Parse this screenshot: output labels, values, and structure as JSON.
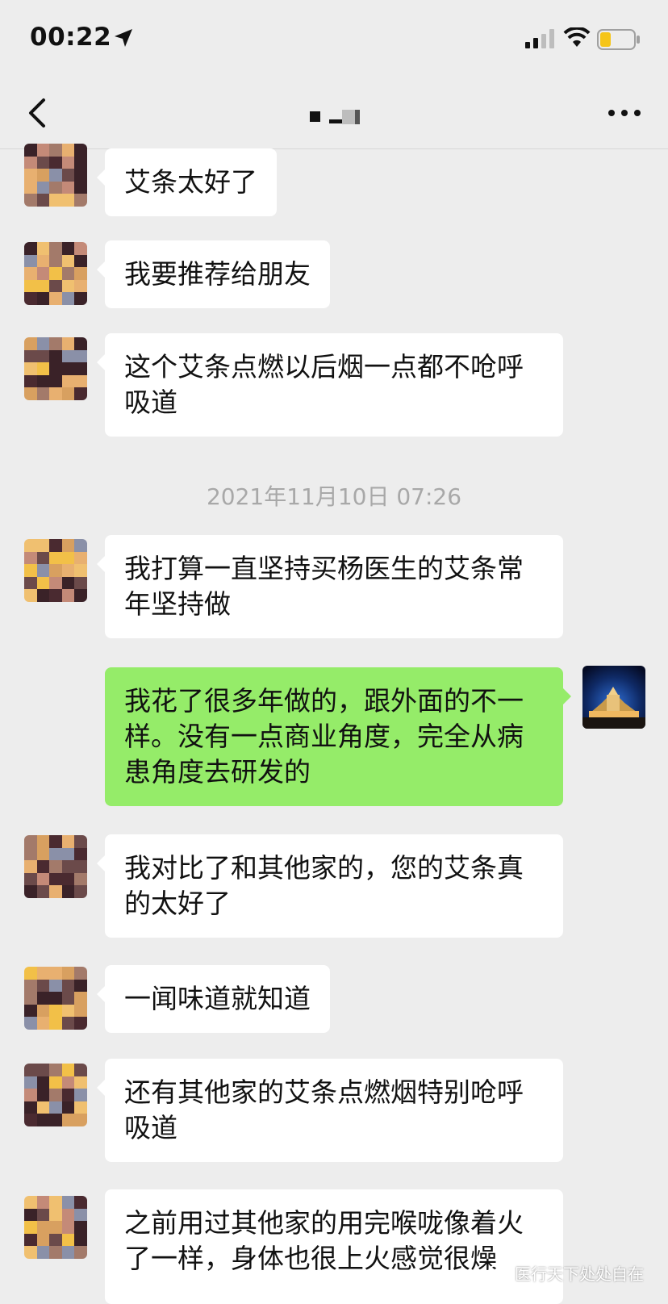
{
  "status_bar": {
    "time": "00:22",
    "icons": [
      "location-arrow-icon",
      "cellular-signal-icon",
      "wifi-icon",
      "battery-low-icon"
    ],
    "battery_color": "#f5c518"
  },
  "nav": {
    "back_icon": "chevron-left-icon",
    "title": "■ ▁▒",
    "more_icon": "ellipsis-icon"
  },
  "messages": [
    {
      "direction": "in",
      "text": "艾条太好了"
    },
    {
      "direction": "in",
      "text": "我要推荐给朋友"
    },
    {
      "direction": "in",
      "text": "这个艾条点燃以后烟一点都不呛呼吸道"
    },
    {
      "direction": "in",
      "text": "我打算一直坚持买杨医生的艾条常年坚持做"
    },
    {
      "direction": "out",
      "text": "我花了很多年做的，跟外面的不一样。没有一点商业角度，完全从病患角度去研发的"
    },
    {
      "direction": "in",
      "text": "我对比了和其他家的，您的艾条真的太好了"
    },
    {
      "direction": "in",
      "text": "一闻味道就知道"
    },
    {
      "direction": "in",
      "text": "还有其他家的艾条点燃烟特别呛呼吸道"
    },
    {
      "direction": "in",
      "text": "之前用过其他家的用完喉咙像着火了一样，身体也很上火感觉很燥"
    }
  ],
  "timestamp": "2021年11月10日 07:26",
  "watermark": "医行天下处处自在",
  "colors": {
    "background": "#ededed",
    "incoming_bubble": "#ffffff",
    "outgoing_bubble": "#95ec69"
  }
}
